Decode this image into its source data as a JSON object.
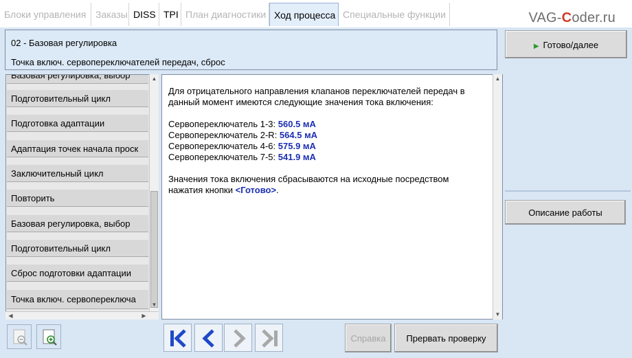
{
  "tabs": [
    {
      "label": "Блоки управления",
      "state": "disabled"
    },
    {
      "label": "Заказы",
      "state": "disabled"
    },
    {
      "label": "DISS",
      "state": "enabled"
    },
    {
      "label": "TPI",
      "state": "enabled"
    },
    {
      "label": "План диагностики",
      "state": "disabled"
    },
    {
      "label": "Ход процесса",
      "state": "active"
    },
    {
      "label": "Специальные функции",
      "state": "disabled"
    }
  ],
  "watermark": {
    "pre": "VAG-",
    "accent": "C",
    "post": "oder.ru"
  },
  "header": {
    "title": "02 - Базовая регулировка",
    "subtitle": "Точка включ. сервопереключателей передач, сброс"
  },
  "right_panel": {
    "ready_label": "Готово/далее",
    "description_label": "Описание работы"
  },
  "steps_list": {
    "items": [
      "Базовая регулировка, выбор",
      "Подготовительный цикл",
      "Подготовка адаптации",
      "Адаптация точек начала проск",
      "Заключительный цикл",
      "Повторить",
      "Базовая регулировка, выбор",
      "Подготовительный цикл",
      "Сброс подготовки адаптации",
      "Точка включ. сервопереключа"
    ]
  },
  "content": {
    "intro_line1": "Для отрицательного направления клапанов переключателей передач в",
    "intro_line2": "данный момент имеются следующие значения тока включения:",
    "measurements": [
      {
        "label": "Сервопереключатель 1-3: ",
        "value": "560.5  мA"
      },
      {
        "label": "Сервопереключатель 2-R: ",
        "value": "564.5  мA"
      },
      {
        "label": "Сервопереключатель 4-6: ",
        "value": "575.9  мA"
      },
      {
        "label": "Сервопереключатель 7-5: ",
        "value": "541.9  мA"
      }
    ],
    "note_line1": "Значения тока включения сбрасываются на исходные посредством",
    "note_line2_prefix": "нажатия кнопки ",
    "note_line2_button": "<Готово>",
    "note_line2_suffix": "."
  },
  "toolbar": {
    "help_label": "Справка",
    "abort_label": "Прервать проверку"
  },
  "colors": {
    "panel_bg": "#d9e6f4",
    "value_blue": "#1c2fb2",
    "nav_blue": "#1f49c9",
    "play_green": "#2e9a2e"
  }
}
